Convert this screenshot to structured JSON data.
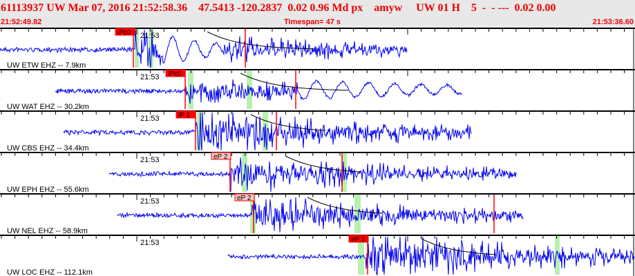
{
  "header": {
    "title": "61113937 UW Mar 07, 2016 21:52:58.36    47.5413 -120.2837  0.02 0.96 Md px    amyw     UW 01 H    5  -  - ---  0.02 0.00",
    "start_time": "21:52:49.82",
    "timespan": "Timespan=  47 s",
    "end_time": "21:53:36.60"
  },
  "colors": {
    "trace": "#0000ee",
    "pick": "#ff0000",
    "pick_weak": "#f4c4c4",
    "window": "#b8f0b0"
  },
  "traces": [
    {
      "station": "UW ETW EHZ -- 7.9km",
      "minute": "21:53",
      "phase": "iPc0"
    },
    {
      "station": "UW WAT EHZ -- 30.2km",
      "minute": "21:53",
      "phase": "iPc0"
    },
    {
      "station": "UW CBS EHZ -- 34.4km",
      "minute": "21:53",
      "phase": "iP 1"
    },
    {
      "station": "UW EPH EHZ -- 55.6km",
      "minute": "21:53",
      "phase": "eP 2"
    },
    {
      "station": "UW NEL EHZ -- 58.9km",
      "minute": "21:53",
      "phase": "eP 2"
    },
    {
      "station": "UW LOC EHZ -- 112.1km",
      "minute": "21:53",
      "phase": "eP 2"
    }
  ]
}
